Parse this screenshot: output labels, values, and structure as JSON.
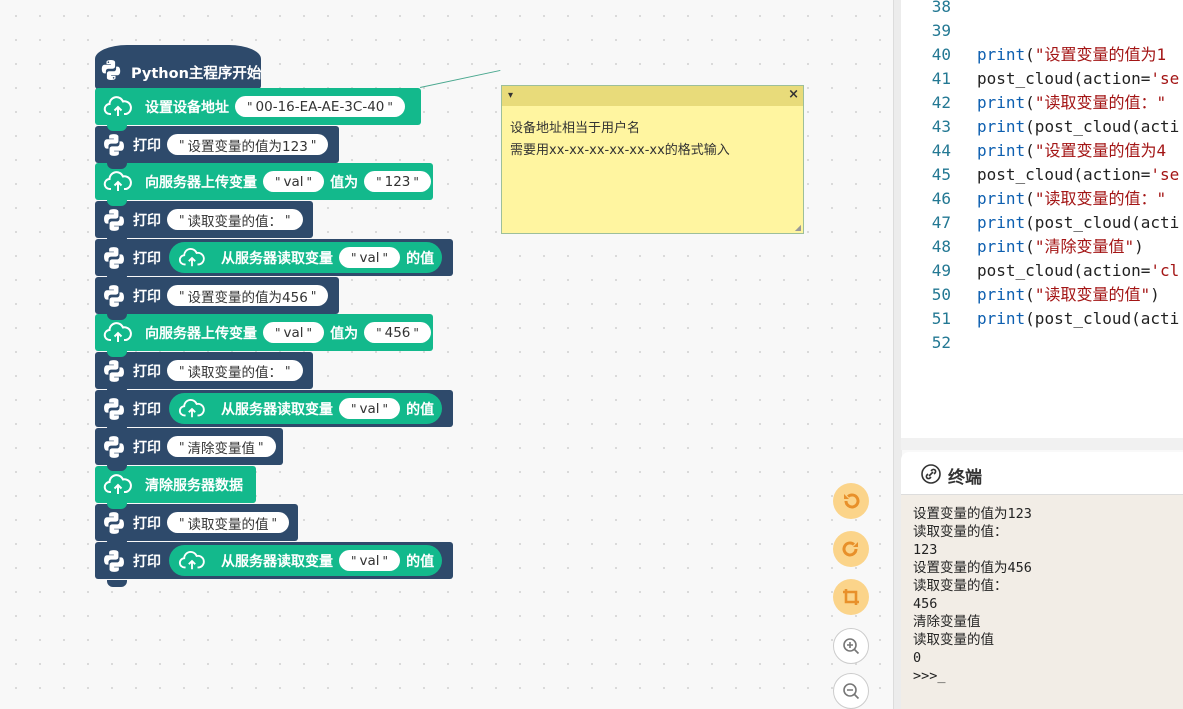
{
  "blocks": {
    "hat_label": "Python主程序开始",
    "print_label": "打印",
    "set_device": {
      "label": "设置设备地址",
      "value": "00-16-EA-AE-3C-40"
    },
    "print1": "设置变量的值为123",
    "upload1": {
      "label": "向服务器上传变量",
      "var": "val",
      "as": "值为",
      "value": "123"
    },
    "print2": "读取变量的值：",
    "read1": {
      "label": "从服务器读取变量",
      "var": "val",
      "suffix": "的值"
    },
    "print3": "设置变量的值为456",
    "upload2": {
      "label": "向服务器上传变量",
      "var": "val",
      "as": "值为",
      "value": "456"
    },
    "print4": "读取变量的值：",
    "read2": {
      "label": "从服务器读取变量",
      "var": "val",
      "suffix": "的值"
    },
    "print5": "清除变量值",
    "clear": "清除服务器数据",
    "print6": "读取变量的值",
    "read3": {
      "label": "从服务器读取变量",
      "var": "val",
      "suffix": "的值"
    }
  },
  "comment": {
    "line1": "设备地址相当于用户名",
    "line2": "需要用xx-xx-xx-xx-xx-xx的格式输入",
    "close": "×",
    "toggle": "▾"
  },
  "toolbar": [
    "undo-icon",
    "redo-icon",
    "crop-icon",
    "zoom-in-icon",
    "zoom-out-icon"
  ],
  "code": [
    {
      "n": "38",
      "kw": "",
      "rest": ""
    },
    {
      "n": "39",
      "kw": "",
      "rest": ""
    },
    {
      "n": "40",
      "kw": "print",
      "pre": "(",
      "str": "\"设置变量的值为1",
      "rest": ""
    },
    {
      "n": "41",
      "kw": "",
      "rest": "post_cloud(action=",
      "str": "'se"
    },
    {
      "n": "42",
      "kw": "print",
      "pre": "(",
      "str": "\"读取变量的值：\"",
      "rest": ""
    },
    {
      "n": "43",
      "kw": "print",
      "pre": "(post_cloud(acti",
      "str": "",
      "rest": ""
    },
    {
      "n": "44",
      "kw": "print",
      "pre": "(",
      "str": "\"设置变量的值为4",
      "rest": ""
    },
    {
      "n": "45",
      "kw": "",
      "rest": "post_cloud(action=",
      "str": "'se"
    },
    {
      "n": "46",
      "kw": "print",
      "pre": "(",
      "str": "\"读取变量的值：\"",
      "rest": ""
    },
    {
      "n": "47",
      "kw": "print",
      "pre": "(post_cloud(acti",
      "str": "",
      "rest": ""
    },
    {
      "n": "48",
      "kw": "print",
      "pre": "(",
      "str": "\"清除变量值\"",
      "rest": ")"
    },
    {
      "n": "49",
      "kw": "",
      "rest": "post_cloud(action=",
      "str": "'cl"
    },
    {
      "n": "50",
      "kw": "print",
      "pre": "(",
      "str": "\"读取变量的值\"",
      "rest": ")"
    },
    {
      "n": "51",
      "kw": "print",
      "pre": "(post_cloud(acti",
      "str": "",
      "rest": ""
    },
    {
      "n": "52",
      "kw": "",
      "rest": ""
    }
  ],
  "terminal": {
    "title": "终端",
    "lines": [
      "设置变量的值为123",
      "读取变量的值：",
      "123",
      "设置变量的值为456",
      "读取变量的值：",
      "456",
      "清除变量值",
      "读取变量的值",
      "0",
      ">>>_"
    ]
  }
}
